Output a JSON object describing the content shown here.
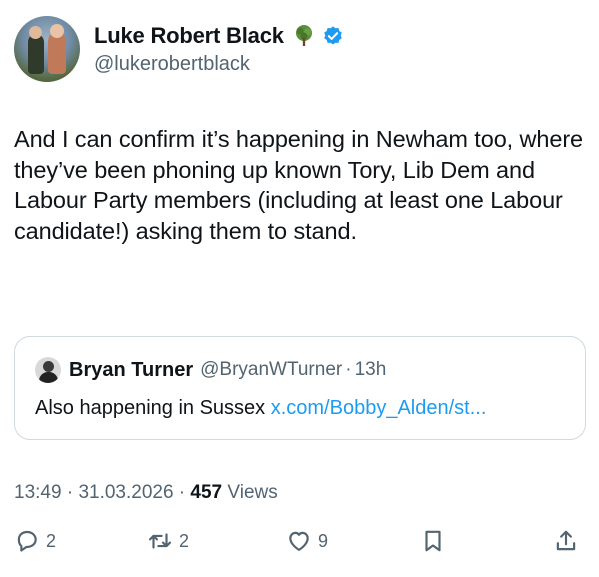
{
  "author": {
    "display_name": "Luke Robert Black",
    "handle": "@lukerobertblack",
    "badges": [
      "tree-icon",
      "verified-icon"
    ]
  },
  "tweet": {
    "text": "And I can confirm it’s happening in Newham too, where they’ve been phoning up known Tory, Lib Dem and Labour Party members (including at least one Labour candidate!) asking them to stand."
  },
  "quote": {
    "name": "Bryan Turner",
    "handle": "@BryanWTurner",
    "separator": "·",
    "time": "13h",
    "text": "Also happening in Sussex",
    "link": "x.com/Bobby_Alden/st..."
  },
  "meta": {
    "time": "13:49",
    "sep1": " · ",
    "date": "31.03.2026",
    "sep2": " · ",
    "views_count": "457",
    "views_label": " Views"
  },
  "actions": {
    "replies": "2",
    "reposts": "2",
    "likes": "9"
  },
  "colors": {
    "text": "#0f1419",
    "secondary": "#536471",
    "link": "#1d9bf0",
    "verified": "#1d9bf0",
    "border": "#cfd9de"
  }
}
